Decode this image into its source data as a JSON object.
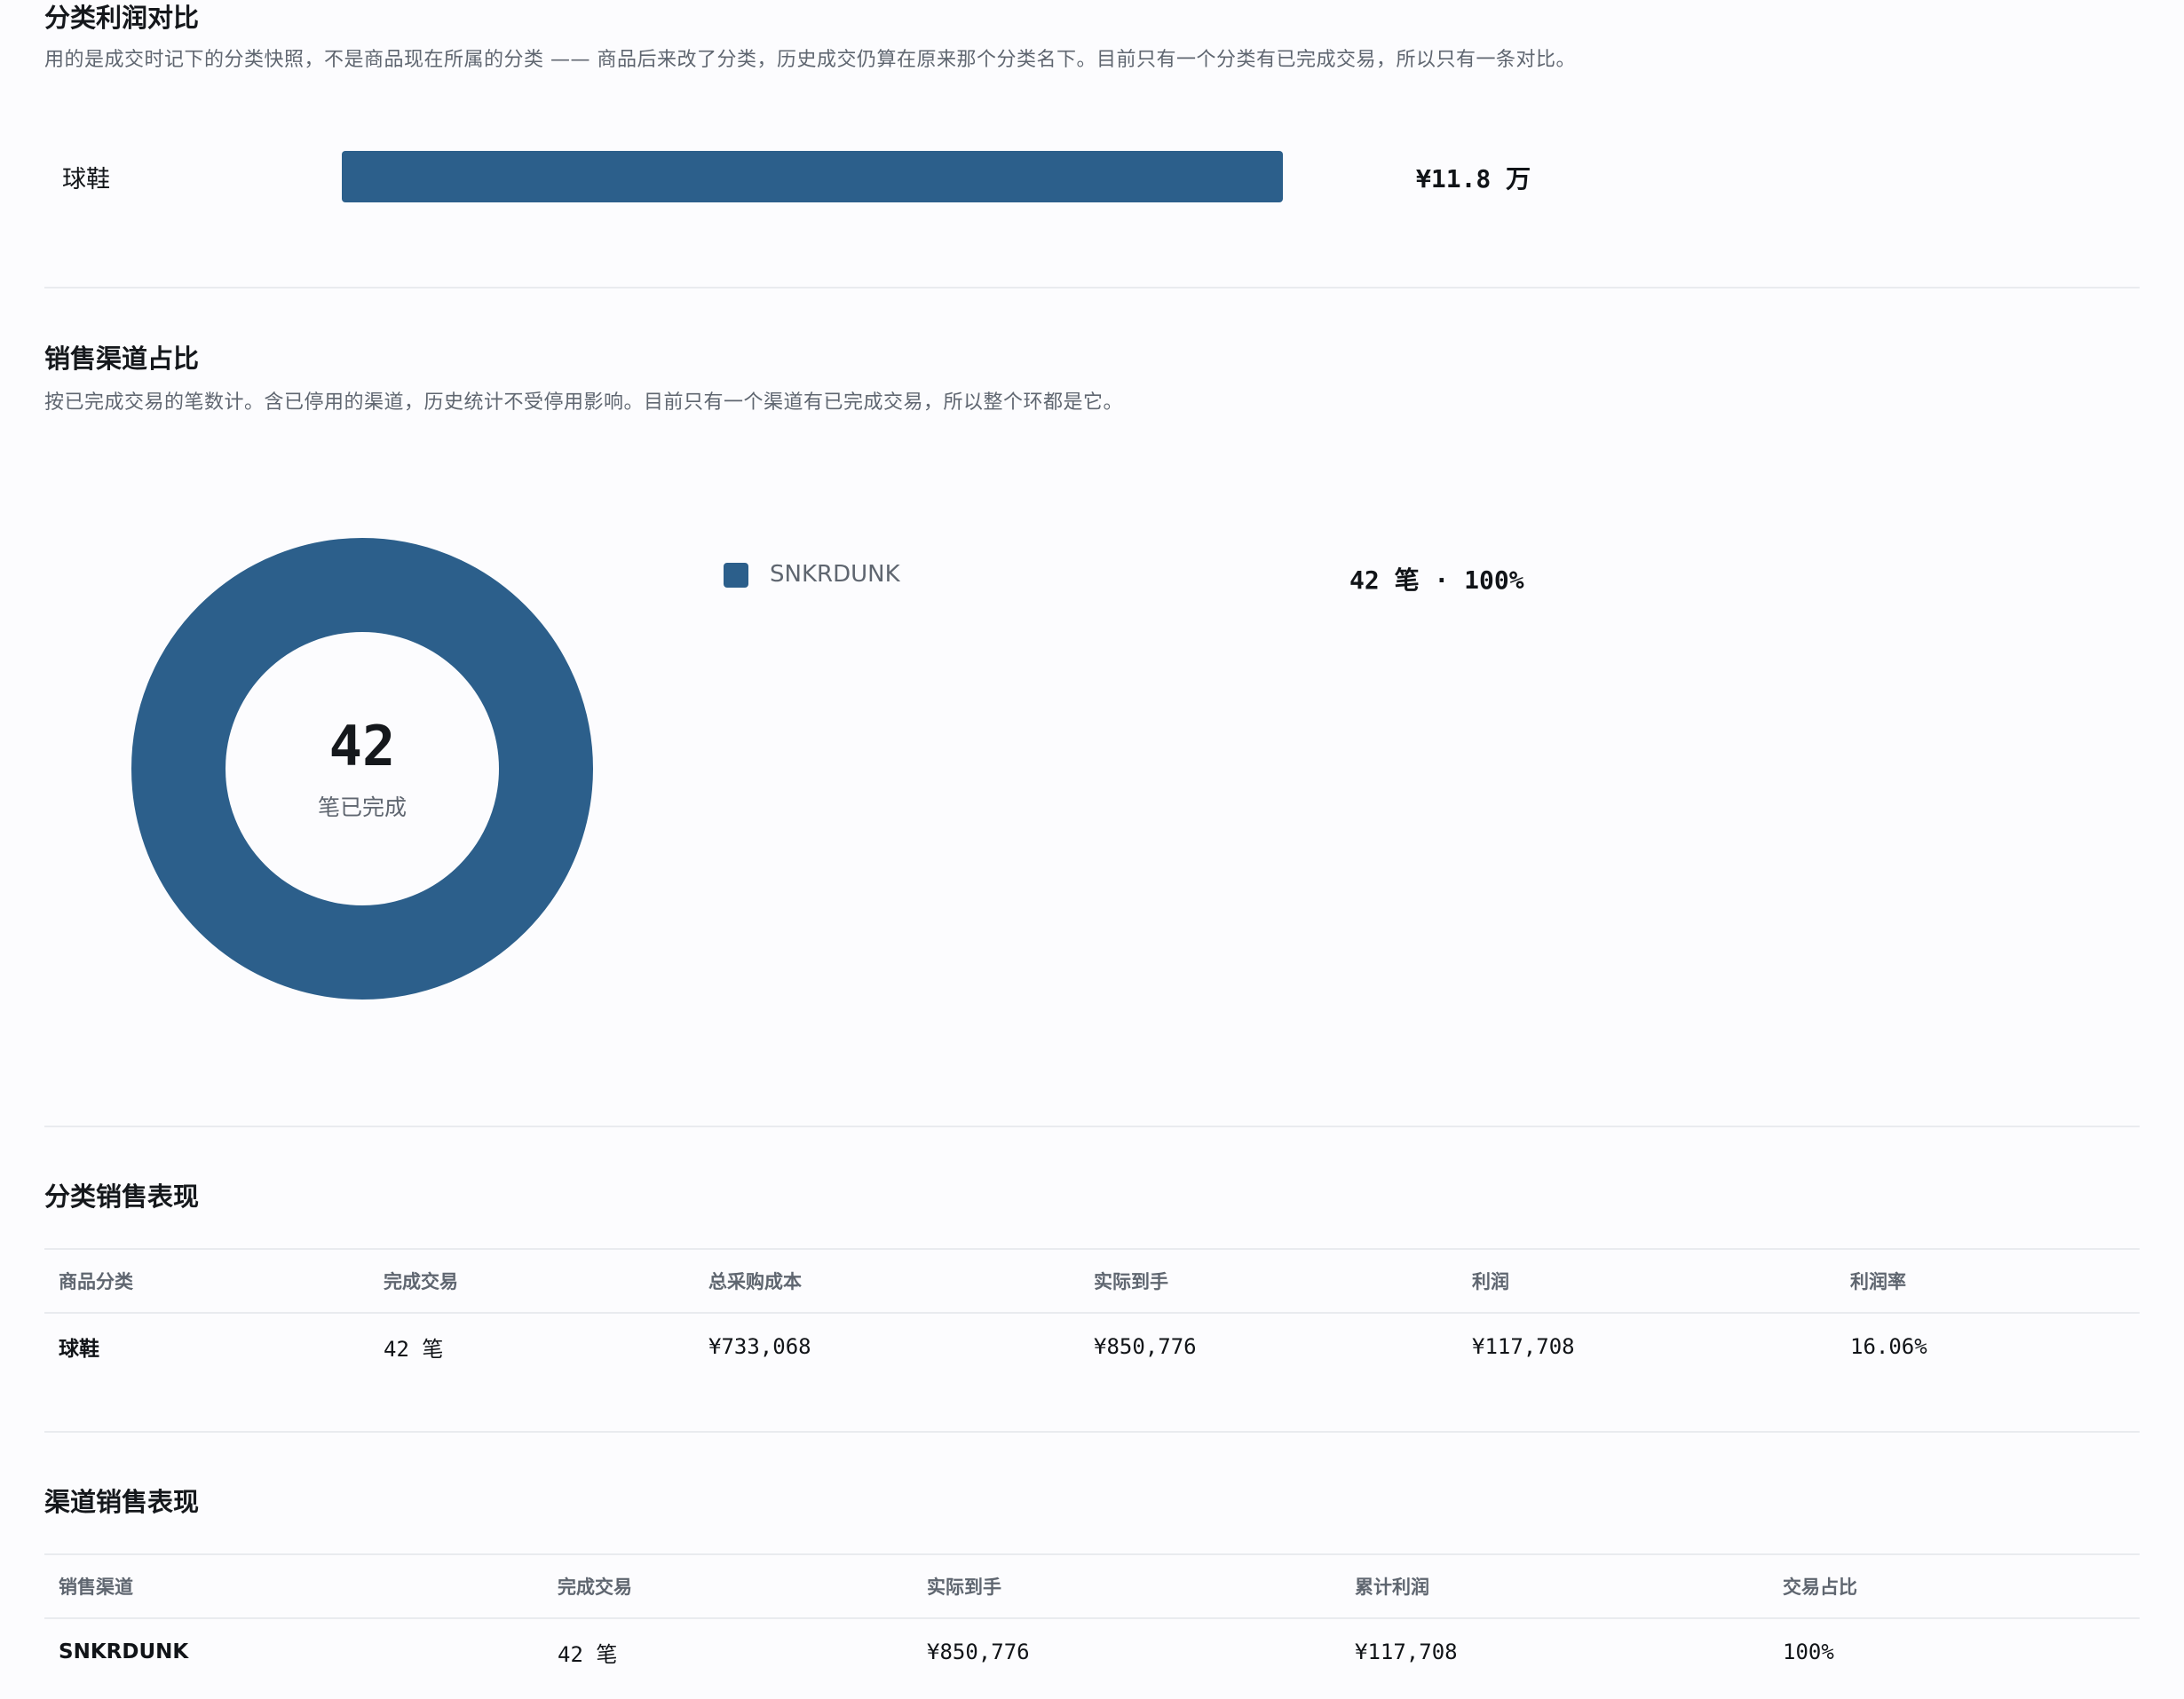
{
  "category_profit": {
    "title": "分类利润对比",
    "description": "用的是成交时记下的分类快照，不是商品现在所属的分类 —— 商品后来改了分类，历史成交仍算在原来那个分类名下。目前只有一个分类有已完成交易，所以只有一条对比。",
    "bars": [
      {
        "label": "球鞋",
        "value_text": "¥11.8 万",
        "fraction": 1.0
      }
    ],
    "bar_color": "#2c5f8b"
  },
  "channel_share": {
    "title": "销售渠道占比",
    "description": "按已完成交易的笔数计。含已停用的渠道，历史统计不受停用影响。目前只有一个渠道有已完成交易，所以整个环都是它。",
    "center_number": "42",
    "center_label": "笔已完成",
    "legend": [
      {
        "name": "SNKRDUNK",
        "value_text": "42 笔 · 100%",
        "color": "#2c5f8b"
      }
    ]
  },
  "chart_data": {
    "type": "pie",
    "categories": [
      "SNKRDUNK"
    ],
    "values": [
      42
    ]
  },
  "category_table": {
    "title": "分类销售表现",
    "columns": [
      "商品分类",
      "完成交易",
      "总采购成本",
      "实际到手",
      "利润",
      "利润率"
    ],
    "rows": [
      [
        "球鞋",
        "42 笔",
        "¥733,068",
        "¥850,776",
        "¥117,708",
        "16.06%"
      ]
    ]
  },
  "channel_table": {
    "title": "渠道销售表现",
    "columns": [
      "销售渠道",
      "完成交易",
      "实际到手",
      "累计利润",
      "交易占比"
    ],
    "rows": [
      [
        "SNKRDUNK",
        "42 笔",
        "¥850,776",
        "¥117,708",
        "100%"
      ]
    ]
  }
}
